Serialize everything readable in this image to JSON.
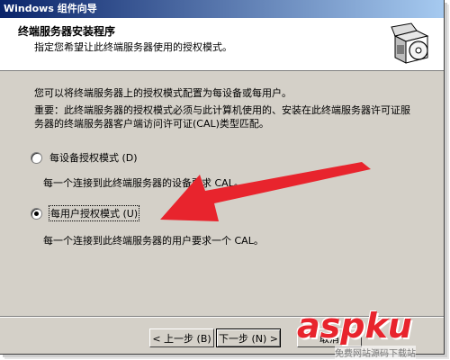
{
  "window": {
    "title": "Windows 组件向导"
  },
  "header": {
    "title": "终端服务器安装程序",
    "subtitle": "指定您希望让此终端服务器使用的授权模式。",
    "icon": "installer-box-cd-icon"
  },
  "content": {
    "intro": "您可以将终端服务器上的授权模式配置为每设备或每用户。",
    "note": "重要：此终端服务器的授权模式必须与此计算机使用的、安装在此终端服务器许可证服务器的终端服务器客户端访问许可证(CAL)类型匹配。",
    "options": [
      {
        "label": "每设备授权模式 (D)",
        "description": "每一个连接到此终端服务器的设备要求 CAL。",
        "selected": false
      },
      {
        "label": "每用户授权模式 (U)",
        "description": "每一个连接到此终端服务器的用户要求一个 CAL。",
        "selected": true
      }
    ]
  },
  "buttons": {
    "back": "< 上一步 (B)",
    "next": "下一步 (N) >",
    "cancel": "取消"
  },
  "annotation": {
    "arrow_color": "#e8242d"
  },
  "watermark": {
    "text": "aspku",
    "subtext": "免费网站源码下载站"
  }
}
